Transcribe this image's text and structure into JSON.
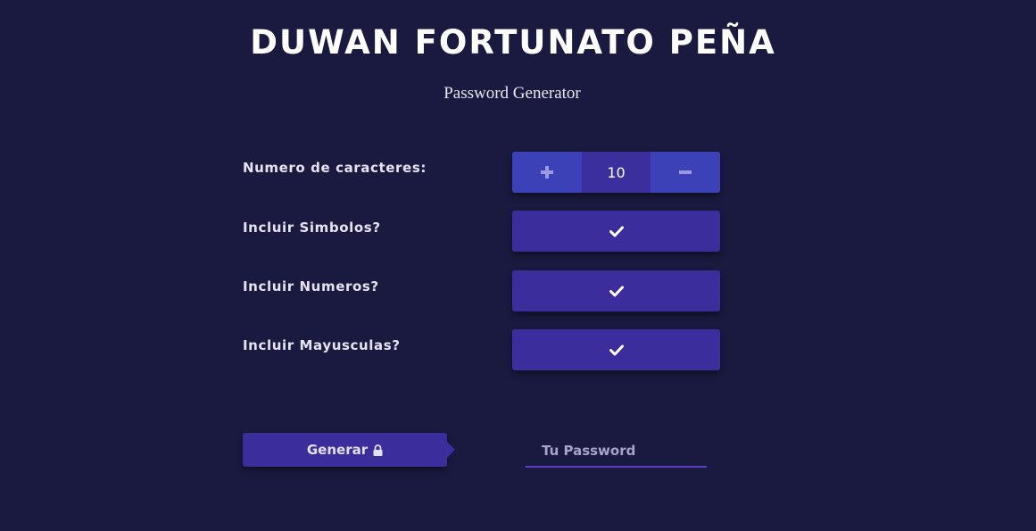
{
  "header": {
    "title": "DUWAN FORTUNATO PEÑA",
    "subtitle": "Password Generator"
  },
  "settings": {
    "length": {
      "label": "Numero de caracteres:",
      "value": "10",
      "increment_icon": "plus-icon",
      "decrement_icon": "minus-icon"
    },
    "symbols": {
      "label": "Incluir Simbolos?",
      "checked": true,
      "icon": "check-icon"
    },
    "numbers": {
      "label": "Incluir Numeros?",
      "checked": true,
      "icon": "check-icon"
    },
    "uppercase": {
      "label": "Incluir Mayusculas?",
      "checked": true,
      "icon": "check-icon"
    }
  },
  "actions": {
    "generate_label": "Generar",
    "generate_icon": "lock-icon"
  },
  "output": {
    "placeholder": "Tu Password",
    "value": ""
  },
  "colors": {
    "background": "#1a1a40",
    "button": "#3c2d9c",
    "stepper_button": "#3d41b8",
    "underline": "#5a3fc4"
  }
}
